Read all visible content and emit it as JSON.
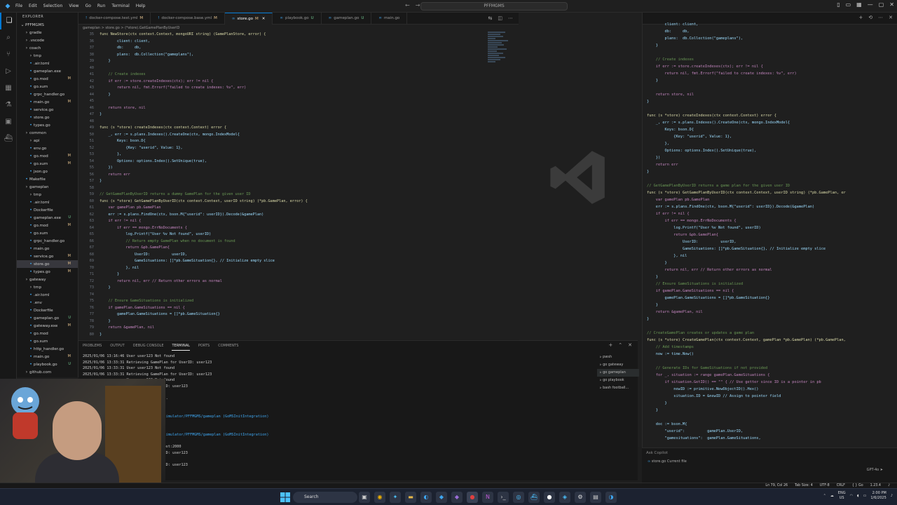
{
  "titlebar": {
    "menu": [
      "File",
      "Edit",
      "Selection",
      "View",
      "Go",
      "Run",
      "Terminal",
      "Help"
    ],
    "command_center": "PFFMGMS"
  },
  "explorer": {
    "header": "EXPLORER",
    "root": "PFFMGMS",
    "items": [
      {
        "label": "gradle",
        "type": "folder",
        "depth": 1
      },
      {
        "label": ".vscode",
        "type": "folder",
        "depth": 1
      },
      {
        "label": "coach",
        "type": "folder",
        "depth": 1
      },
      {
        "label": "tmp",
        "type": "folder",
        "depth": 2
      },
      {
        "label": ".air.toml",
        "type": "file",
        "depth": 2
      },
      {
        "label": "gameplan.exe",
        "type": "file",
        "depth": 2
      },
      {
        "label": "go.mod",
        "type": "file",
        "depth": 2,
        "badge": "M"
      },
      {
        "label": "go.sum",
        "type": "file",
        "depth": 2
      },
      {
        "label": "grpc_handler.go",
        "type": "file",
        "depth": 2
      },
      {
        "label": "main.go",
        "type": "file",
        "depth": 2,
        "badge": "M"
      },
      {
        "label": "service.go",
        "type": "file",
        "depth": 2
      },
      {
        "label": "store.go",
        "type": "file",
        "depth": 2
      },
      {
        "label": "types.go",
        "type": "file",
        "depth": 2
      },
      {
        "label": "common",
        "type": "folder",
        "depth": 1
      },
      {
        "label": "api",
        "type": "folder",
        "depth": 2
      },
      {
        "label": "env.go",
        "type": "file",
        "depth": 2
      },
      {
        "label": "go.mod",
        "type": "file",
        "depth": 2,
        "badge": "M"
      },
      {
        "label": "go.sum",
        "type": "file",
        "depth": 2,
        "badge": "M"
      },
      {
        "label": "json.go",
        "type": "file",
        "depth": 2
      },
      {
        "label": "Makefile",
        "type": "file",
        "depth": 1
      },
      {
        "label": "gameplan",
        "type": "folder",
        "depth": 1
      },
      {
        "label": "tmp",
        "type": "folder",
        "depth": 2
      },
      {
        "label": ".air.toml",
        "type": "file",
        "depth": 2
      },
      {
        "label": "Dockerfile",
        "type": "file",
        "depth": 2
      },
      {
        "label": "gameplan.exe",
        "type": "file",
        "depth": 2,
        "badge": "U"
      },
      {
        "label": "go.mod",
        "type": "file",
        "depth": 2,
        "badge": "M"
      },
      {
        "label": "go.sum",
        "type": "file",
        "depth": 2
      },
      {
        "label": "grpc_handler.go",
        "type": "file",
        "depth": 2
      },
      {
        "label": "main.go",
        "type": "file",
        "depth": 2
      },
      {
        "label": "service.go",
        "type": "file",
        "depth": 2,
        "badge": "M"
      },
      {
        "label": "store.go",
        "type": "file",
        "depth": 2,
        "badge": "M",
        "selected": true
      },
      {
        "label": "types.go",
        "type": "file",
        "depth": 2,
        "badge": "M"
      },
      {
        "label": "gateway",
        "type": "folder",
        "depth": 1
      },
      {
        "label": "tmp",
        "type": "folder",
        "depth": 2
      },
      {
        "label": ".air.toml",
        "type": "file",
        "depth": 2
      },
      {
        "label": ".env",
        "type": "file",
        "depth": 2
      },
      {
        "label": "Dockerfile",
        "type": "file",
        "depth": 2
      },
      {
        "label": "gameplan.go",
        "type": "file",
        "depth": 2,
        "badge": "U"
      },
      {
        "label": "gateway.exe",
        "type": "file",
        "depth": 2,
        "badge": "M"
      },
      {
        "label": "go.mod",
        "type": "file",
        "depth": 2
      },
      {
        "label": "go.sum",
        "type": "file",
        "depth": 2
      },
      {
        "label": "http_handler.go",
        "type": "file",
        "depth": 2
      },
      {
        "label": "main.go",
        "type": "file",
        "depth": 2,
        "badge": "M"
      },
      {
        "label": "playbook.go",
        "type": "file",
        "depth": 2,
        "badge": "U"
      },
      {
        "label": "github.com",
        "type": "folder",
        "depth": 1
      }
    ]
  },
  "tabs": [
    {
      "label": "docker-compose.test.yml",
      "mod": "M",
      "active": false
    },
    {
      "label": "docker-compose.base.yml",
      "mod": "M",
      "active": false
    },
    {
      "label": "store.go",
      "mod": "M",
      "active": true
    },
    {
      "label": "playbook.go",
      "mod": "U",
      "active": false
    },
    {
      "label": "gameplan.go",
      "mod": "U",
      "active": false
    },
    {
      "label": "main.go",
      "mod": "",
      "active": false
    }
  ],
  "breadcrumb": "gameplan > store.go > (*store).GetGamePlanByUserID",
  "editor": {
    "line_numbers": [
      "35",
      "36",
      "37",
      "38",
      "39",
      "40",
      "41",
      "42",
      "43",
      "44",
      "45",
      "46",
      "47",
      "48",
      "49",
      "50",
      "51",
      "52",
      "53",
      "54",
      "55",
      "56",
      "57",
      "58",
      "59",
      "60",
      "61",
      "62",
      "63",
      "64",
      "65",
      "66",
      "67",
      "68",
      "69",
      "70",
      "71",
      "72",
      "73",
      "74",
      "75",
      "76",
      "77",
      "78",
      "79",
      "80"
    ],
    "lines": [
      "func NewStore(ctx context.Context, mongoURI string) (GamePlanStore, error) {",
      "        client: client,",
      "        db:     db,",
      "        plans:  db.Collection(\"gameplans\"),",
      "    }",
      "",
      "    // Create indexes",
      "    if err := store.createIndexes(ctx); err != nil {",
      "        return nil, fmt.Errorf(\"failed to create indexes: %v\", err)",
      "    }",
      "",
      "    return store, nil",
      "}",
      "",
      "func (s *store) createIndexes(ctx context.Context) error {",
      "    _, err := s.plans.Indexes().CreateOne(ctx, mongo.IndexModel{",
      "        Keys: bson.D{",
      "            {Key: \"userid\", Value: 1},",
      "        },",
      "        Options: options.Index().SetUnique(true),",
      "    })",
      "    return err",
      "}",
      "",
      "// GetGamePlanByUserID returns a dummy GamePlan for the given user ID",
      "func (s *store) GetGamePlanByUserID(ctx context.Context, userID string) (*pb.GamePlan, error) {",
      "    var gamePlan pb.GamePlan",
      "    err := s.plans.FindOne(ctx, bson.M{\"userid\": userID}).Decode(&gamePlan)",
      "    if err != nil {",
      "        if err == mongo.ErrNoDocuments {",
      "            log.Printf(\"User %v Not found\", userID)",
      "            // Return empty GamePlan when no document is found",
      "            return &pb.GamePlan{",
      "                UserID:          userID,",
      "                GameSituations: []*pb.GameSituation{}, // Initialize empty slice",
      "            }, nil",
      "        }",
      "        return nil, err // Return other errors as normal",
      "    }",
      "",
      "    // Ensure GameSituations is initialized",
      "    if gamePlan.GameSituations == nil {",
      "        gamePlan.GameSituations = []*pb.GameSituation{}",
      "    }",
      "    return &gamePlan, nil",
      "}"
    ]
  },
  "group2": {
    "lines": [
      "        client: client,",
      "        db:     db,",
      "        plans:  db.Collection(\"gameplans\"),",
      "    }",
      "",
      "    // Create indexes",
      "    if err := store.createIndexes(ctx); err != nil {",
      "        return nil, fmt.Errorf(\"failed to create indexes: %v\", err)",
      "    }",
      "",
      "    return store, nil",
      "}",
      "",
      "func (s *store) createIndexes(ctx context.Context) error {",
      "    _, err := s.plans.Indexes().CreateOne(ctx, mongo.IndexModel{",
      "        Keys: bson.D{",
      "            {Key: \"userid\", Value: 1},",
      "        },",
      "        Options: options.Index().SetUnique(true),",
      "    })",
      "    return err",
      "}",
      "",
      "// GetGamePlanByUserID returns a game plan for the given user ID",
      "func (s *store) GetGamePlanByUserID(ctx context.Context, userID string) (*pb.GamePlan, er",
      "    var gamePlan pb.GamePlan",
      "    err := s.plans.FindOne(ctx, bson.M{\"userid\": userID}).Decode(&gamePlan)",
      "    if err != nil {",
      "        if err == mongo.ErrNoDocuments {",
      "            log.Printf(\"User %v Not found\", userID)",
      "            return &pb.GamePlan{",
      "                UserID:          userID,",
      "                GameSituations: []*pb.GameSituation{}, // Initialize empty slice",
      "            }, nil",
      "        }",
      "        return nil, err // Return other errors as normal",
      "    }",
      "    // Ensure GameSituations is initialized",
      "    if gamePlan.GameSituations == nil {",
      "        gamePlan.GameSituations = []*pb.GameSituation{}",
      "    }",
      "    return &gamePlan, nil",
      "}",
      "",
      "// CreateGamePlan creates or updates a game plan",
      "func (s *store) CreateGamePlan(ctx context.Context, gamePlan *pb.GamePlan) (*pb.GamePlan,",
      "    // Add timestamps",
      "    now := time.Now()",
      "",
      "    // Generate IDs for GameSituations if not provided",
      "    for _, situation := range gamePlan.GameSituations {",
      "        if situation.GetID() == \"\" { // Use getter since ID is a pointer in pb",
      "            newID := primitive.NewObjectID().Hex()",
      "            situation.ID = &newID // Assign to pointer field",
      "        }",
      "    }",
      "",
      "    doc := bson.M{",
      "        \"userid\":          gamePlan.UserID,",
      "        \"gamesituations\":  gamePlan.GameSituations,"
    ]
  },
  "panel": {
    "tabs": [
      "PROBLEMS",
      "OUTPUT",
      "DEBUG CONSOLE",
      "TERMINAL",
      "PORTS",
      "COMMENTS"
    ],
    "active_tab": "TERMINAL",
    "terminal_lines": [
      "2025/01/06 13:16:46 User user123 Not found",
      "2025/01/06 13:33:31 Retrieving GamePlan for UserID: user123",
      "2025/01/06 13:33:31 User user123 Not found",
      "2025/01/06 13:33:31 Retrieving GamePlan for UserID: user123",
      "                    User user123 Not found",
      "                    GamePlan for UserID: user123",
      "                    Not found",
      "                    raceful shutdown...",
      "                    own completed",
      "",
      "                    it Repos/footballsimulator/PFFMGMS/gameplan (GoMSInitIntegration)",
      "",
      "",
      "                    it Repos/footballsimulator/PFFMGMS/gameplan (GoMSInitIntegration)",
      "",
      "                    started at localhost:2000",
      "                    GamePlan for UserID: user123",
      "                    Not found",
      "                    GamePlan for UserID: user123",
      "                    Not found"
    ],
    "terminals": [
      "pwsh",
      "go gateway",
      "go gameplan",
      "go playbook",
      "bash football..."
    ]
  },
  "chat": {
    "placeholder": "Ask Copilot",
    "context": "store.go  Current file",
    "model": "GPT-4o"
  },
  "statusbar": {
    "position": "Ln 79, Col 26",
    "tab_size": "Tab Size: 4",
    "encoding": "UTF-8",
    "eol": "CRLF",
    "language": "{ } Go",
    "version": "1.23.4"
  },
  "taskbar": {
    "search": "Search",
    "lang": "ENG",
    "region": "US",
    "time": "2:00 PM",
    "date": "1/6/2025"
  },
  "colors": {
    "accent": "#0078d4",
    "editor_bg": "#1f1f1f",
    "sidebar_bg": "#181818"
  }
}
